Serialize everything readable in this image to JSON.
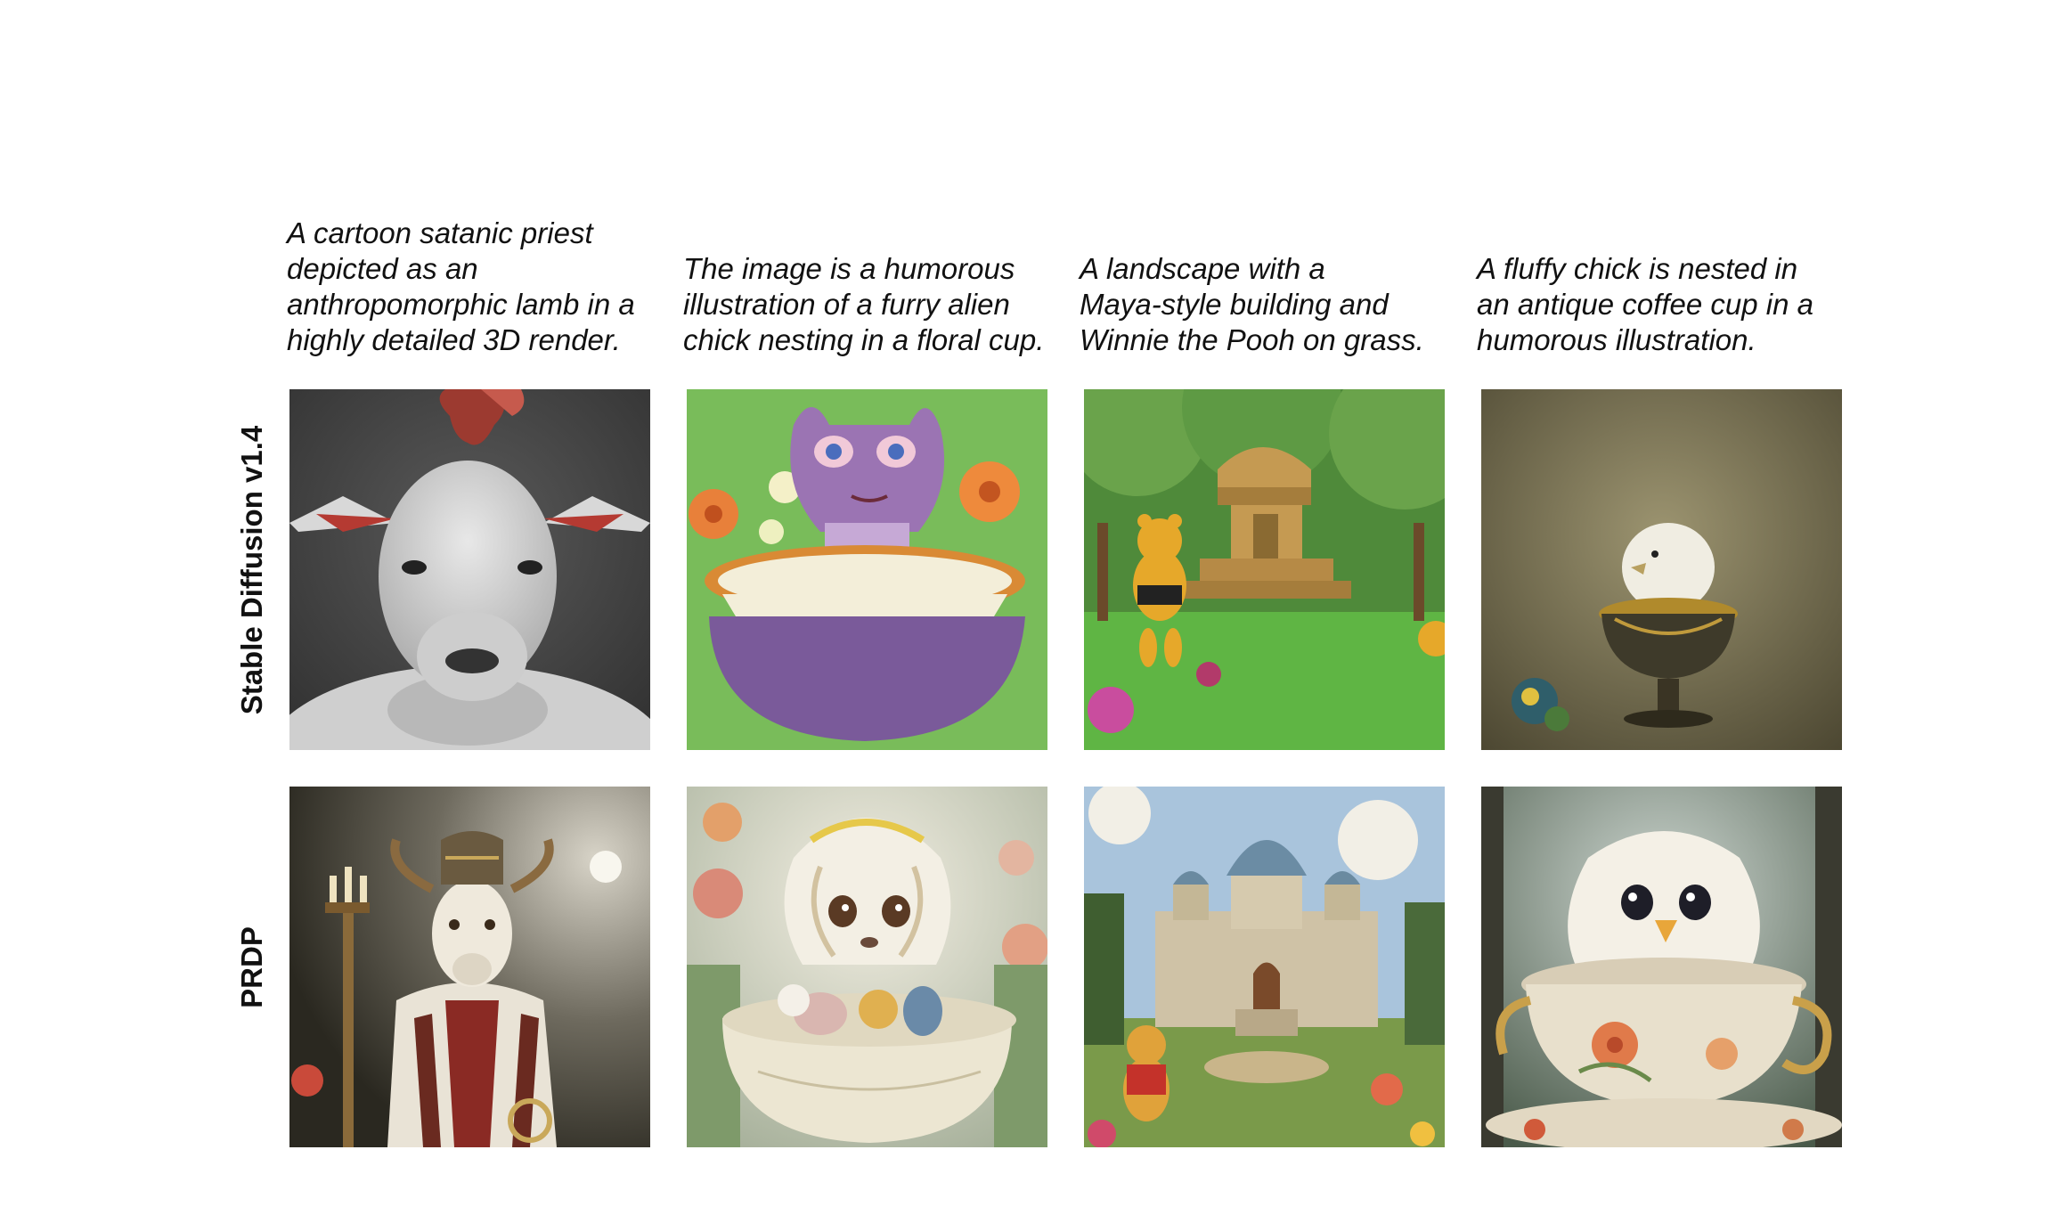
{
  "captions": [
    "A cartoon satanic priest\ndepicted as an\nanthropomorphic lamb in a\nhighly detailed 3D render.",
    "The image is a humorous\nillustration of a furry alien\nchick nesting in a floral cup.",
    "A landscape with a\nMaya-style building and\nWinnie the Pooh on grass.",
    "A fluffy chick is nested in\nan antique coffee cup in a\nhumorous illustration."
  ],
  "rows": [
    {
      "label": "Stable Diffusion v1.4",
      "images": [
        "grey 3D-rendered lamb head with white ears and red horn-like object",
        "cartoon purple alien creature in purple bowl with orange flowers on green background",
        "cartoon Winnie the Pooh walking in front of a stone domed temple among trees",
        "small white fluffy chick sitting in a gold cup on dark olive background"
      ]
    },
    {
      "label": "PRDP",
      "images": [
        "anthropomorphic goat priest in ornate robe holding candelabra",
        "fluffy creature with swirling white and yellow fur in a decorated cup with flowers and eggs",
        "ornate palace with domes, Winnie the Pooh standing in a flower garden",
        "fluffy white chick with big eyes inside a floral porcelain teacup on saucer"
      ]
    }
  ],
  "colors": {
    "text": "#111111",
    "background": "#ffffff"
  }
}
